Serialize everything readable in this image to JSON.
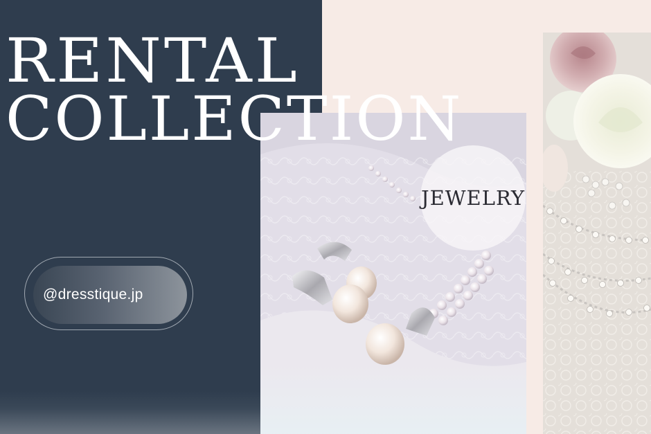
{
  "title": {
    "line1": "RENTAL",
    "line2": "COLLECTION"
  },
  "badge": {
    "label": "JEWELRY"
  },
  "handle": {
    "text": "@dresstique.jp"
  },
  "colors": {
    "navy": "#2f3d4e",
    "cream": "#f7ebe6",
    "white": "#ffffff",
    "badge_text": "#2b2b33"
  },
  "images": [
    {
      "name": "pearl-earrings-necklace-photo"
    },
    {
      "name": "roses-pearl-necklace-photo"
    }
  ]
}
